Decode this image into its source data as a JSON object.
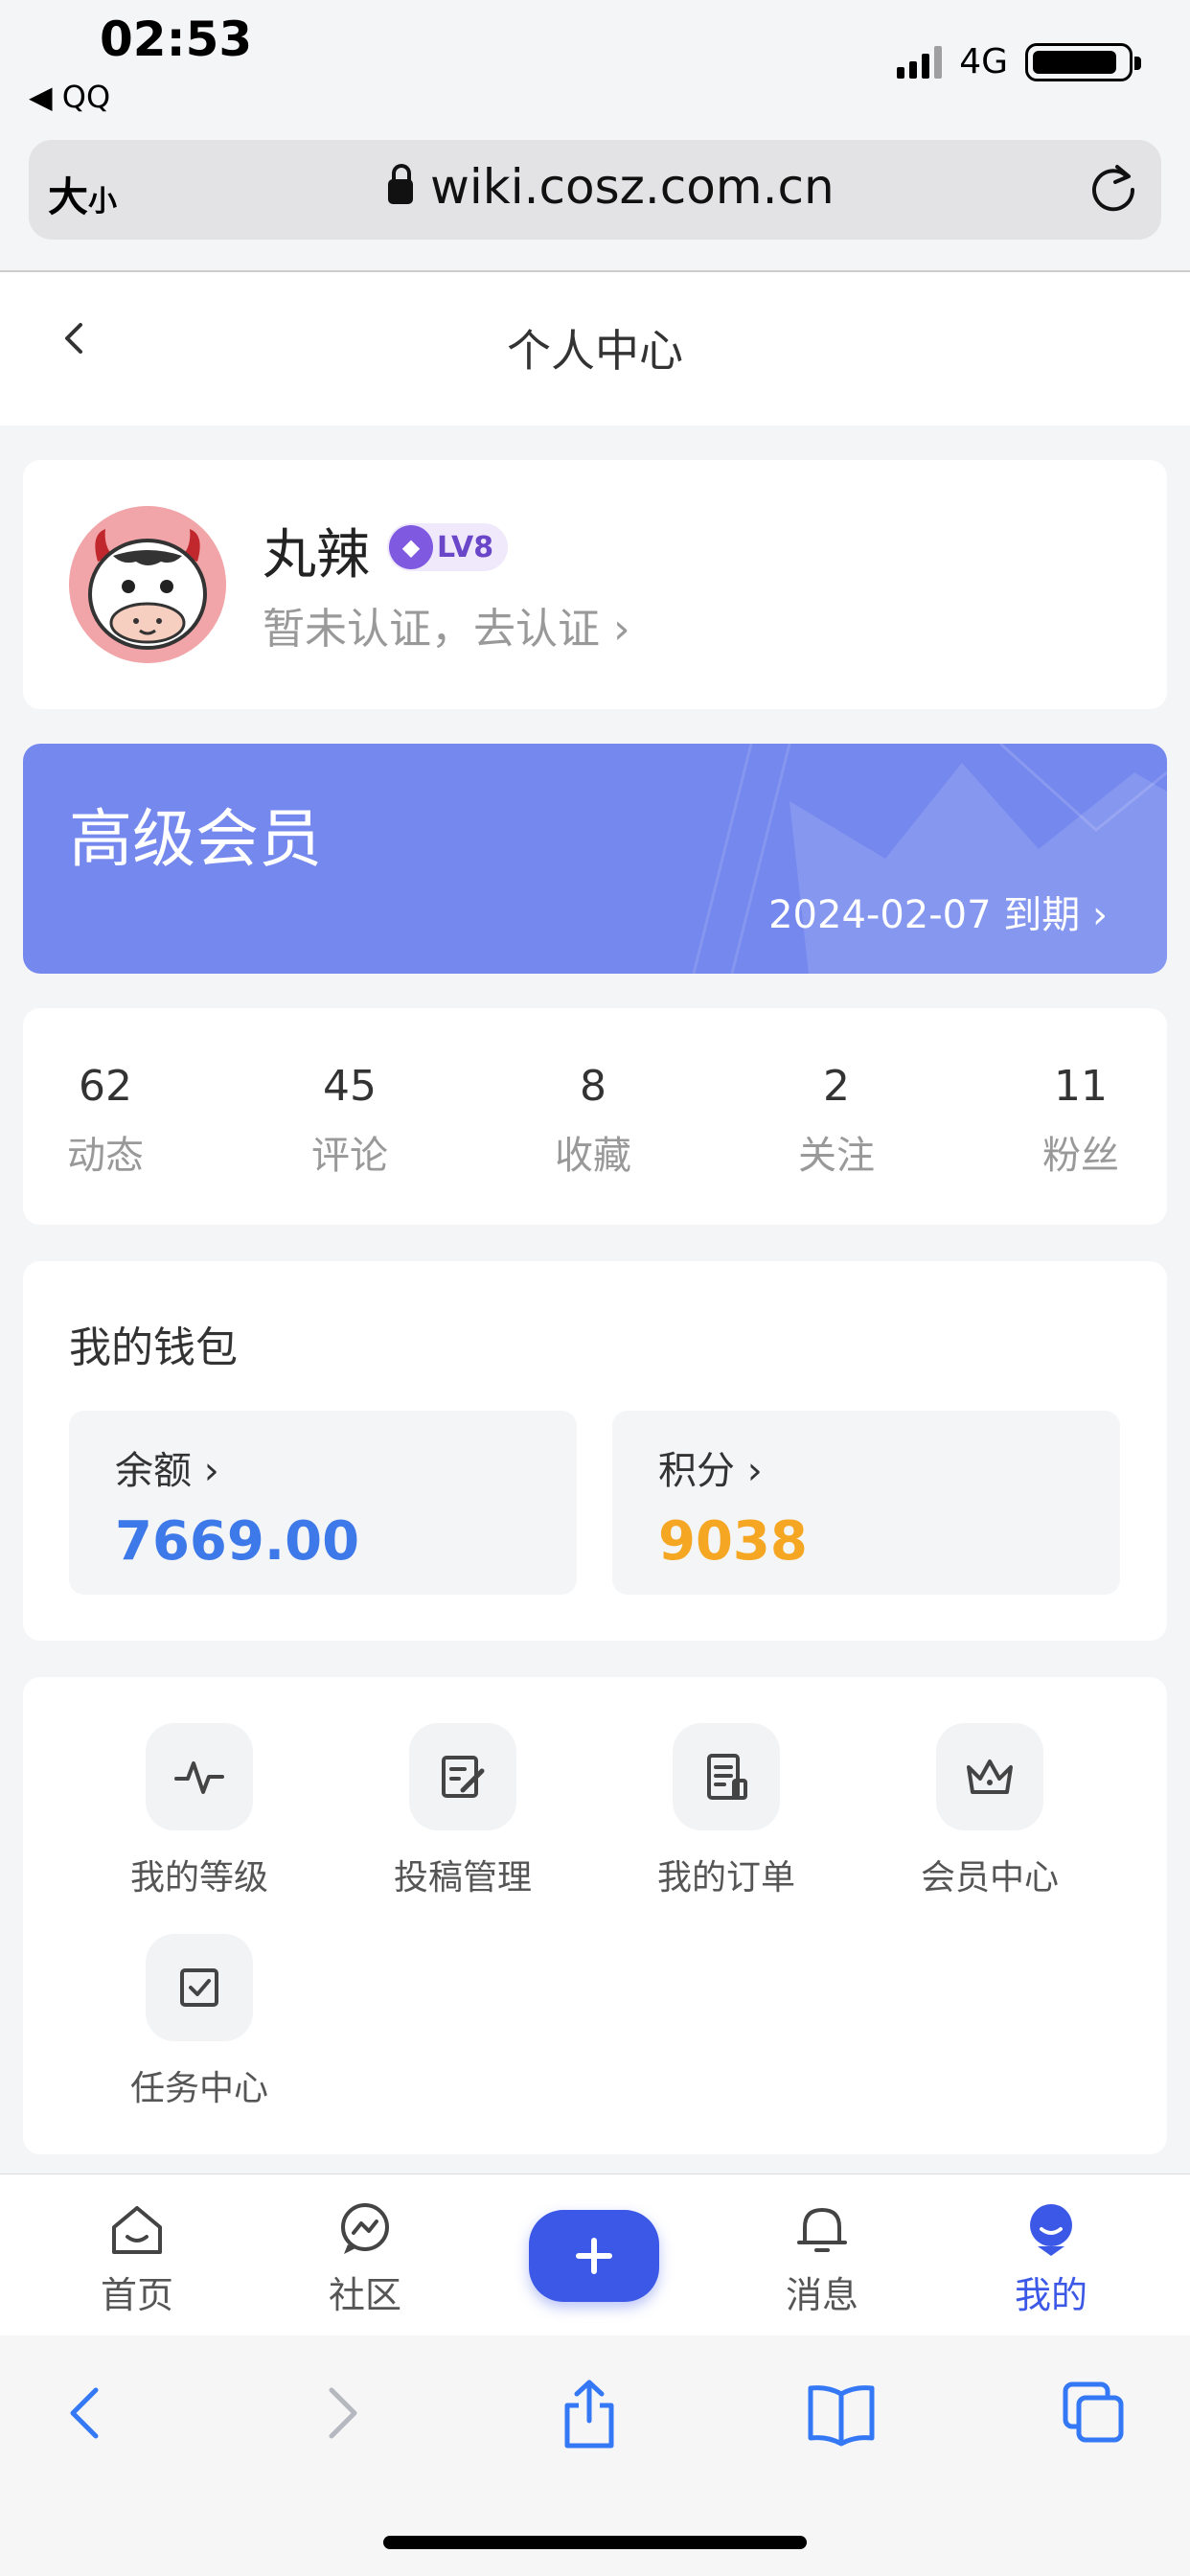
{
  "status_bar": {
    "time": "02:53",
    "back_app": "◀ QQ",
    "network": "4G"
  },
  "browser": {
    "text_size_big": "大",
    "text_size_small": "小",
    "url": "wiki.cosz.com.cn"
  },
  "header": {
    "title": "个人中心"
  },
  "profile": {
    "name": "丸辣",
    "level": "LV8",
    "verify_text": "暂未认证，去认证 ›"
  },
  "membership": {
    "title": "高级会员",
    "expire_text": "2024-02-07 到期 ›"
  },
  "stats": [
    {
      "value": "62",
      "label": "动态"
    },
    {
      "value": "45",
      "label": "评论"
    },
    {
      "value": "8",
      "label": "收藏"
    },
    {
      "value": "2",
      "label": "关注"
    },
    {
      "value": "11",
      "label": "粉丝"
    }
  ],
  "wallet": {
    "title": "我的钱包",
    "balance_label": "余额 ›",
    "balance_value": "7669.00",
    "points_label": "积分 ›",
    "points_value": "9038",
    "balance_color": "#3d79e8",
    "points_color": "#f5a623"
  },
  "menu": [
    {
      "label": "我的等级",
      "icon": "activity-icon"
    },
    {
      "label": "投稿管理",
      "icon": "edit-icon"
    },
    {
      "label": "我的订单",
      "icon": "receipt-icon"
    },
    {
      "label": "会员中心",
      "icon": "crown-icon"
    },
    {
      "label": "任务中心",
      "icon": "checkbox-icon"
    }
  ],
  "tabbar": {
    "items": [
      {
        "label": "首页",
        "icon": "home-icon"
      },
      {
        "label": "社区",
        "icon": "chat-icon"
      },
      {
        "label": "消息",
        "icon": "bell-icon"
      },
      {
        "label": "我的",
        "icon": "profile-icon"
      }
    ],
    "active": "我的",
    "accent": "#3c58e6"
  }
}
